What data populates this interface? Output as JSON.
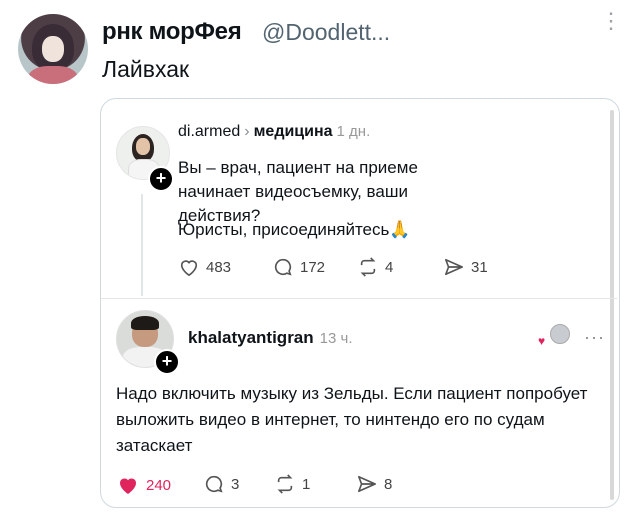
{
  "outer_post": {
    "display_name": "рнк морФея",
    "handle": "@Doodlett...",
    "text": "Лайвхак"
  },
  "quoted_thread": {
    "post1": {
      "username": "di.armed",
      "category": "медицина",
      "time": "1 дн.",
      "text_line1": "Вы – врач, пациент на приеме начинает видеосъемку, ваши действия?",
      "text_line2": "Юристы, присоединяйтесь🙏",
      "likes": "483",
      "comments": "172",
      "reposts": "4",
      "shares": "31"
    },
    "post2": {
      "username": "khalatyantigran",
      "time": "13 ч.",
      "text": "Надо включить музыку из Зельды. Если пациент попробует выложить видео в интернет, то нинтендо его по судам затаскает",
      "likes": "240",
      "comments": "3",
      "reposts": "1",
      "shares": "8"
    }
  },
  "icons": {
    "menu": "⋮",
    "menu_horizontal": "···",
    "plus": "+",
    "chevron": "›"
  },
  "colors": {
    "like_active": "#e0245e",
    "muted": "#536471"
  }
}
